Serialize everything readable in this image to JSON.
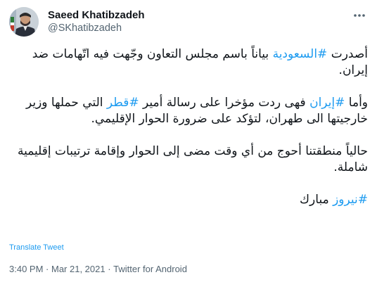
{
  "author": {
    "name": "Saeed Khatibzadeh",
    "handle": "@SKhatibzadeh"
  },
  "icons": {
    "avatar": "avatar-photo",
    "more": "more-options-icon"
  },
  "tweet": {
    "p1": {
      "a": "أصدرت ",
      "tag1": "#السعودية",
      "b": " بياناً باسم مجلس التعاون وجّهت فيه اتّهامات ضد إيران."
    },
    "p2": {
      "a": "وأما ",
      "tag1": "#إيران",
      "b": " فهى ردت مؤخرا على رسالة أمير ",
      "tag2": "#قطر",
      "c": " التي حملها وزير خارجيتها الى طهران، لتؤكد على ضرورة الحوار الإقليمي."
    },
    "p3": "حالياً منطقتنا أحوج من أي وقت مضى إلى الحوار وإقامة ترتيبات إقليمية شاملة.",
    "p4": {
      "tag1": "#نيروز",
      "a": " مبارك"
    }
  },
  "translate_label": "Translate Tweet",
  "meta": {
    "time": "3:40 PM",
    "separator1": " · ",
    "date": "Mar 21, 2021",
    "separator2": " · ",
    "source": "Twitter for Android"
  },
  "colors": {
    "link": "#1d9bf0",
    "secondary_text": "#536471",
    "primary_text": "#0f1419"
  }
}
